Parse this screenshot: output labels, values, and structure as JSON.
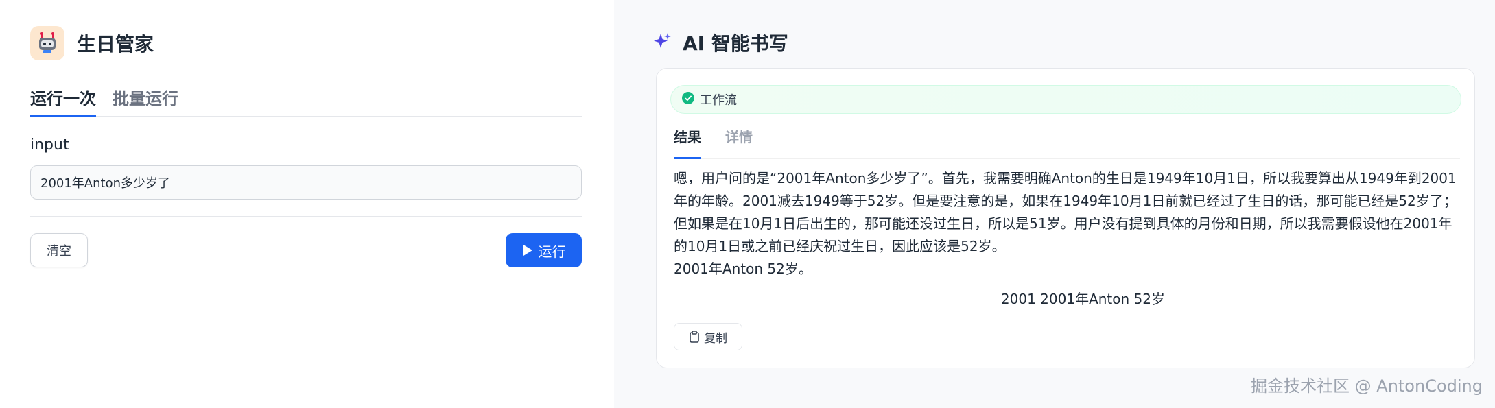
{
  "app": {
    "title": "生日管家",
    "icon": "robot-icon"
  },
  "tabs": [
    {
      "label": "运行一次",
      "active": true
    },
    {
      "label": "批量运行",
      "active": false
    }
  ],
  "form": {
    "input_label": "input",
    "input_value": "2001年Anton多少岁了",
    "clear_label": "清空",
    "run_label": "运行"
  },
  "ai_panel": {
    "title": "AI 智能书写",
    "icon": "sparkle-icon",
    "workflow_label": "工作流",
    "result_tabs": [
      {
        "label": "结果",
        "active": true
      },
      {
        "label": "详情",
        "active": false
      }
    ],
    "result_text": "嗯，用户问的是“2001年Anton多少岁了”。首先，我需要明确Anton的生日是1949年10月1日，所以我要算出从1949年到2001年的年龄。2001减去1949等于52岁。但是要注意的是，如果在1949年10月1日前就已经过了生日的话，那可能已经是52岁了；但如果是在10月1日后出生的，那可能还没过生日，所以是51岁。用户没有提到具体的月份和日期，所以我需要假设他在2001年的10月1日或之前已经庆祝过生日，因此应该是52岁。",
    "result_answer": "2001年Anton 52岁。",
    "result_center": "2001 2001年Anton 52岁",
    "copy_label": "复制"
  },
  "watermark": "掘金技术社区 @ AntonCoding",
  "colors": {
    "accent": "#1c64f2",
    "success": "#10b981"
  }
}
